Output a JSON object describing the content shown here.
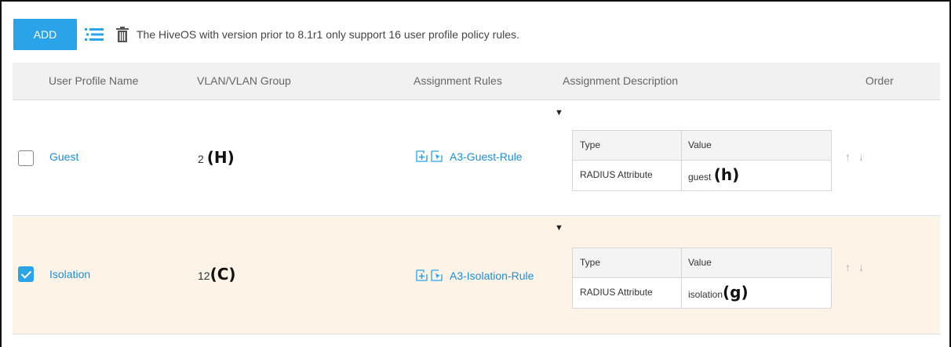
{
  "toolbar": {
    "add_label": "ADD",
    "notice": "The HiveOS with version prior to 8.1r1 only support 16 user profile policy rules."
  },
  "columns": {
    "name": "User Profile Name",
    "vlan": "VLAN/VLAN Group",
    "rules": "Assignment Rules",
    "description": "Assignment Description",
    "order": "Order"
  },
  "rows": [
    {
      "checked": false,
      "name": "Guest",
      "vlan": "2",
      "vlan_annotation": "(H)",
      "rule": "A3-Guest-Rule",
      "caret": "▼",
      "desc_headers": [
        "Type",
        "Value"
      ],
      "desc_type": "RADIUS Attribute",
      "desc_value": "guest",
      "desc_annotation": "(h)"
    },
    {
      "checked": true,
      "name": "Isolation",
      "vlan": "12",
      "vlan_annotation": "(C)",
      "rule": "A3-Isolation-Rule",
      "caret": "▼",
      "desc_headers": [
        "Type",
        "Value"
      ],
      "desc_type": "RADIUS Attribute",
      "desc_value": "isolation",
      "desc_annotation": "(g)"
    }
  ],
  "order_icons": {
    "up": "↑",
    "down": "↓"
  },
  "icons": [
    "list-icon",
    "trash-icon",
    "add-rule-icon",
    "select-rule-icon",
    "caret-down-icon",
    "arrow-up-icon",
    "arrow-down-icon"
  ],
  "colors": {
    "accent": "#2aa3e8",
    "link": "#1f8ed6",
    "selected_row": "#fdf3e7"
  }
}
